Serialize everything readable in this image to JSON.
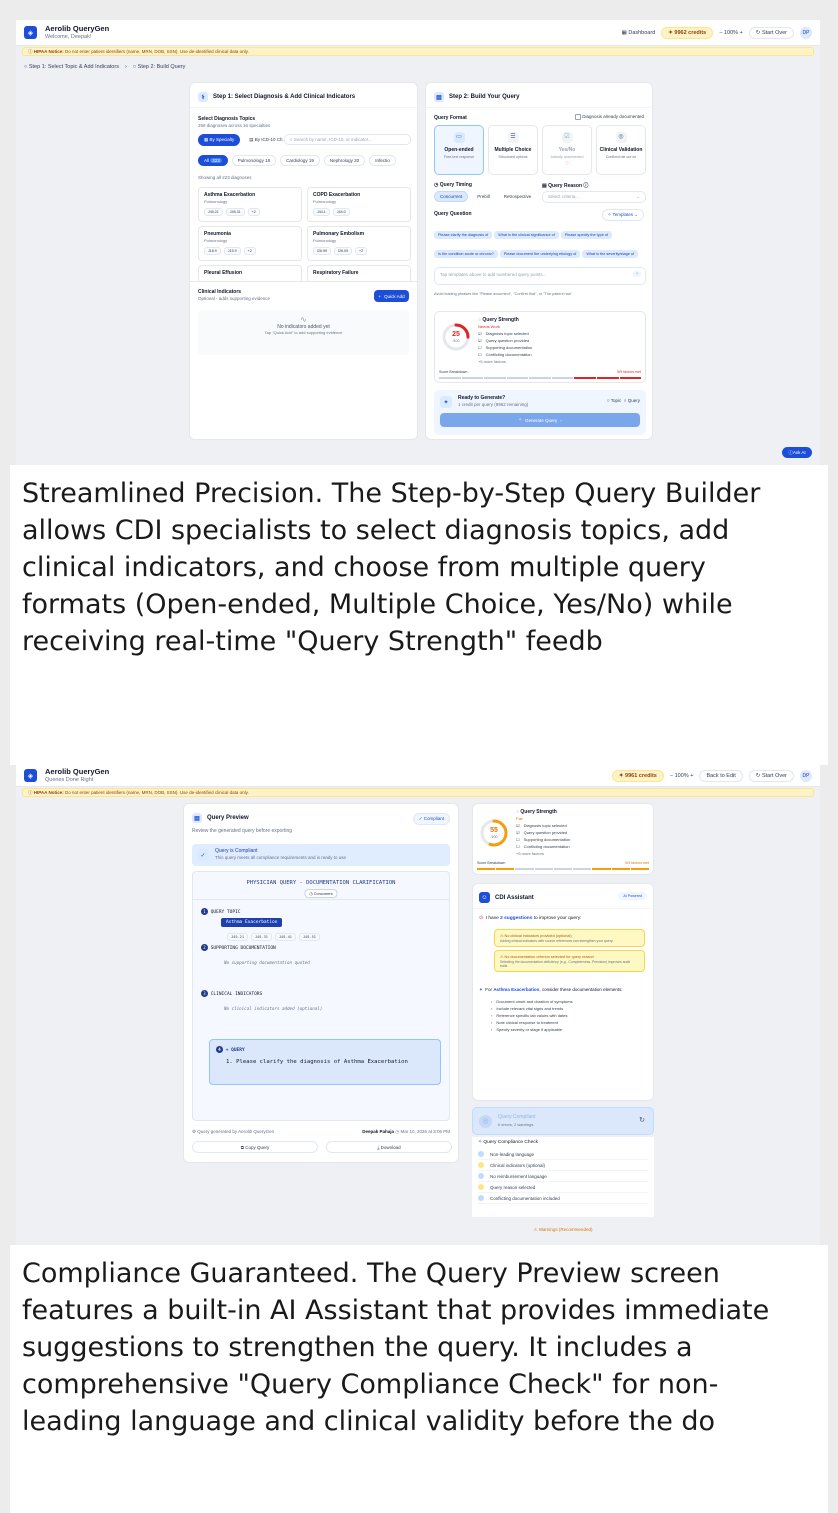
{
  "shot1": {
    "app_title": "Aerolib QueryGen",
    "welcome": "Welcome, Deepak!",
    "dashboard": "Dashboard",
    "credits": "9962 credits",
    "zoom": "100%",
    "start_over": "Start Over",
    "avatar": "DP",
    "notice_label": "HIPAA Notice:",
    "notice_text": "Do not enter patient identifiers (name, MRN, DOB, SSN). Use de-identified clinical data only.",
    "step1": "Step 1: Select Topic & Add Indicators",
    "step2": "Step 2: Build Query",
    "left": {
      "title": "Step 1: Select Diagnosis & Add Clinical Indicators",
      "topics_label": "Select Diagnosis Topics",
      "topics_sub": "258 diagnoses across 16 specialties",
      "by_specialty": "By Specialty",
      "by_icd": "By ICD-10 Ch.",
      "search_placeholder": "Search by name, ICD-10, or indicator...",
      "cats": [
        {
          "label": "All",
          "count": "223"
        },
        {
          "label": "Pulmonology",
          "count": "18"
        },
        {
          "label": "Cardiology",
          "count": "19"
        },
        {
          "label": "Nephrology",
          "count": "20"
        },
        {
          "label": "Infectio",
          "count": ""
        }
      ],
      "showing": "Showing all 223 diagnoses",
      "diagnoses": [
        {
          "name": "Asthma Exacerbation",
          "spec": "Pulmonology",
          "codes": [
            "J45.21",
            "J45.31",
            "+2"
          ]
        },
        {
          "name": "COPD Exacerbation",
          "spec": "Pulmonology",
          "codes": [
            "J44.1",
            "J44.0"
          ]
        },
        {
          "name": "Pneumonia",
          "spec": "Pulmonology",
          "codes": [
            "J18.9",
            "J15.9",
            "+2"
          ]
        },
        {
          "name": "Pulmonary Embolism",
          "spec": "Pulmonology",
          "codes": [
            "I26.99",
            "I26.09",
            "+2"
          ]
        },
        {
          "name": "Pleural Effusion",
          "spec": "",
          "codes": []
        },
        {
          "name": "Respiratory Failure",
          "spec": "",
          "codes": []
        }
      ],
      "ci_title": "Clinical Indicators",
      "ci_sub": "Optional - adds supporting evidence",
      "quick_add": "Quick Add",
      "none_title": "No indicators added yet",
      "none_sub": "Tap \"Quick Add\" to add supporting evidence"
    },
    "right": {
      "title": "Step 2: Build Your Query",
      "format_label": "Query Format",
      "already_doc": "Diagnosis already documented",
      "formats": [
        {
          "name": "Open-ended",
          "desc": "Free-text response"
        },
        {
          "name": "Multiple Choice",
          "desc": "Structured options"
        },
        {
          "name": "Yes/No",
          "desc": "Already documented"
        },
        {
          "name": "Clinical Validation",
          "desc": "Confirm/rule out dx"
        }
      ],
      "timing_label": "Query Timing",
      "timing": [
        "Concurrent",
        "Prebill",
        "Retrospective"
      ],
      "reason_label": "Query Reason",
      "reason_placeholder": "Select criteria...",
      "question_label": "Query Question",
      "templates": "Templates",
      "chips": [
        "Please clarify the diagnosis of",
        "What is the clinical significance of",
        "Please specify the type of",
        "Is the condition acute or chronic?",
        "Please document the underlying etiology of",
        "What is the severity/stage of"
      ],
      "textarea_placeholder": "Tap templates above to add numbered query points...",
      "avoid": "Avoid leading phrases like \"Please document\", \"Confirm that\", or \"The patient has\"",
      "strength_title": "Query Strength",
      "strength_status": "Needs Work",
      "strength_score": "25",
      "strength_max": "/100",
      "factors": [
        "Diagnosis topic selected",
        "Query question provided",
        "Supporting documentation",
        "Conflicting documentation",
        "+5 more factors"
      ],
      "breakdown": "Score Breakdown",
      "breakdown_right": "5/9 factors met",
      "ready_title": "Ready to Generate?",
      "ready_sub": "1 credit per query (9962 remaining)",
      "topic": "Topic",
      "query": "Query",
      "generate": "Generate Query"
    },
    "ask_ai": "Ask AI"
  },
  "caption1": "Streamlined Precision. The Step-by-Step Query Builder allows CDI specialists to select diagnosis topics, add clinical indicators, and choose from multiple query formats (Open-ended, Multiple Choice, Yes/No) while receiving real-time \"Query Strength\" feedb",
  "shot2": {
    "app_title": "Aerolib QueryGen",
    "tagline": "Queries Done Right",
    "credits": "9961 credits",
    "zoom": "100%",
    "back": "Back to Edit",
    "start_over": "Start Over",
    "avatar": "DP",
    "notice_label": "HIPAA Notice:",
    "notice_text": "Do not enter patient identifiers (name, MRN, DOB, SSN). Use de-identified clinical data only.",
    "preview": {
      "title": "Query Preview",
      "compliant_badge": "Compliant",
      "sub": "Review the generated query before exporting",
      "ok_title": "Query is Compliant",
      "ok_sub": "This query meets all compliance requirements and is ready to use",
      "doc_title": "PHYSICIAN QUERY - DOCUMENTATION CLARIFICATION",
      "doc_timing": "Concurrent",
      "s1": "QUERY TOPIC",
      "topic": "Asthma Exacerbation",
      "codes": [
        "J45.21",
        "J45.31",
        "J45.41",
        "J45.51"
      ],
      "s2": "SUPPORTING DOCUMENTATION",
      "s2_empty": "No supporting documentation quoted",
      "s3": "CLINICAL INDICATORS",
      "s3_empty": "No clinical indicators added (optional)",
      "s4": "+ QUERY",
      "q1": "1. Please clarify the diagnosis of Asthma Exacerbation",
      "gen_by": "Query generated by Aerolib QueryGen",
      "author": "Deepak Pahaja",
      "date": "Mar 10, 2026 at 3:06 PM",
      "copy": "Copy Query",
      "download": "Download"
    },
    "strength": {
      "title": "Query Strength",
      "status": "Fair",
      "score": "55",
      "max": "/100",
      "factors": [
        "Diagnosis topic selected",
        "Query question provided",
        "Supporting documentation",
        "Conflicting documentation",
        "+5 more factors"
      ],
      "breakdown": "Score Breakdown",
      "breakdown_right": "5/9 factors met"
    },
    "assistant": {
      "title": "CDI Assistant",
      "badge": "AI Powered",
      "intro_a": "I have ",
      "intro_b": "2 suggestions",
      "intro_c": " to improve your query:",
      "s1_title": "No clinical indicators provided (optional)",
      "s1_sub": "Adding clinical indicators with source references can strengthen your query.",
      "s2_title": "No documentation criterion selected for query reason",
      "s2_sub": "Selecting the documentation deficiency (e.g., Completeness, Precision) improves audit trails.",
      "for_a": "For ",
      "for_b": "Asthma Exacerbation",
      "for_c": ", consider these documentation elements:",
      "elements": [
        "Document onset and duration of symptoms",
        "Include relevant vital signs and trends",
        "Reference specific lab values with dates",
        "Note clinical response to treatment",
        "Specify severity or stage if applicable"
      ]
    },
    "compliant": {
      "title": "Query Compliant",
      "sub": "0 errors, 2 warnings"
    },
    "check": {
      "title": "Query Compliance Check",
      "items": [
        {
          "label": "Non-leading language",
          "tone": "ok"
        },
        {
          "label": "Clinical indicators (optional)",
          "tone": "warn"
        },
        {
          "label": "No reimbursement language",
          "tone": "ok"
        },
        {
          "label": "Query reason selected",
          "tone": "warn"
        },
        {
          "label": "Conflicting documentation included",
          "tone": "ok"
        }
      ],
      "warnings": "Warnings (Recommended)"
    }
  },
  "caption2": "Compliance Guaranteed. The Query Preview screen features a built-in AI Assistant that provides immediate suggestions to strengthen the query. It includes a comprehensive \"Query Compliance Check\" for non-leading language and clinical validity before the do"
}
